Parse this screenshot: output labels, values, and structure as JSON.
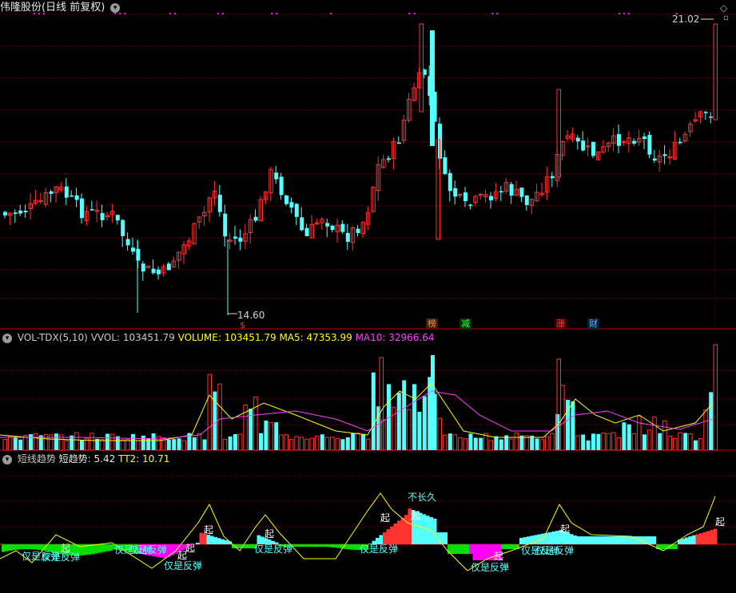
{
  "header": {
    "title": "伟隆股份(日线 前复权)",
    "high_label": "21.02",
    "low_label": "14.60",
    "corner_icon": "diamond-icon"
  },
  "event_tags": [
    {
      "text": "$",
      "color": "#ff3030"
    },
    {
      "text": "榜",
      "color": "#ff8040"
    },
    {
      "text": "减",
      "color": "#40ff40"
    },
    {
      "text": "涨",
      "color": "#ff4040"
    },
    {
      "text": "财",
      "color": "#60a0ff"
    }
  ],
  "volume_panel": {
    "name": "VOL-TDX(5,10)",
    "vvol": "VVOL: 103451.79",
    "volume": "VOLUME: 103451.79",
    "ma5": "MA5: 47353.99",
    "ma10": "MA10: 32966.64"
  },
  "trend_panel": {
    "name": "短线趋势",
    "value": "短趋势: 5.42",
    "tt2": "TT2: 10.71",
    "labels": {
      "rebound_1": "仅是反弹",
      "rebound_2": "仅是反弹",
      "rebound_3": "仅是反弹",
      "rebound_4": "仅是反弹",
      "rebound_5": "仅是反弹",
      "rebound_6": "仅是反弹",
      "rebound_7": "仅是反弹",
      "rebound_8": "仅是反弹",
      "rebound_9": "仅是反弹",
      "rebound_10": "仅是反弹",
      "not_long": "不长久",
      "rise": "起"
    }
  },
  "colors": {
    "up": "#ff3232",
    "down": "#54ffff",
    "ma5": "#ffff00",
    "ma10": "#ff40ff",
    "grid": "#800000",
    "green": "#00e000",
    "magenta": "#ff00ff",
    "text": "#c8c8c8"
  },
  "chart_data": {
    "type": "candlestick",
    "price_max": 21.02,
    "price_min": 14.6,
    "volume_max": 103451.79
  }
}
